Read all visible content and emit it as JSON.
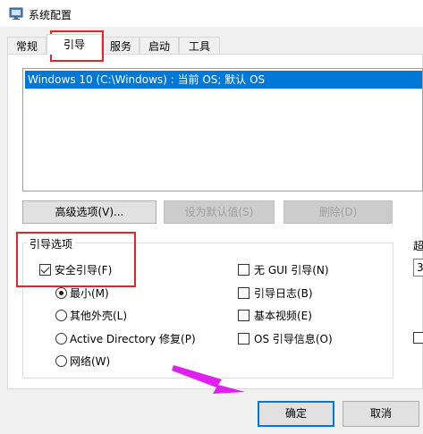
{
  "window": {
    "title": "系统配置"
  },
  "tabs": [
    {
      "label": "常规"
    },
    {
      "label": "引导"
    },
    {
      "label": "服务"
    },
    {
      "label": "启动"
    },
    {
      "label": "工具"
    }
  ],
  "os_list": {
    "selected_item": "Windows 10 (C:\\Windows) : 当前 OS; 默认 OS"
  },
  "buttons": {
    "advanced": "高级选项(V)...",
    "set_default": "设为默认值(S)",
    "delete": "删除(D)",
    "ok": "确定",
    "cancel": "取消"
  },
  "boot_options": {
    "group_label": "引导选项",
    "safe_boot": {
      "label": "安全引导(F)",
      "checked": true
    },
    "minimal": {
      "label": "最小(M)",
      "selected": true
    },
    "alternate_shell": {
      "label": "其他外壳(L)",
      "selected": false
    },
    "active_directory": {
      "label": "Active Directory 修复(P)",
      "selected": false
    },
    "network": {
      "label": "网络(W)",
      "selected": false
    },
    "no_gui": {
      "label": "无 GUI 引导(N)",
      "checked": false
    },
    "boot_log": {
      "label": "引导日志(B)",
      "checked": false
    },
    "base_video": {
      "label": "基本视频(E)",
      "checked": false
    },
    "os_boot_info": {
      "label": "OS 引导信息(O)",
      "checked": false
    }
  },
  "right_edge": {
    "timeout_label_fragment": "超",
    "timeout_value_fragment": "3"
  },
  "colors": {
    "selection": "#0078d7",
    "highlight": "#e8242b",
    "arrow": "#e11ff0"
  }
}
